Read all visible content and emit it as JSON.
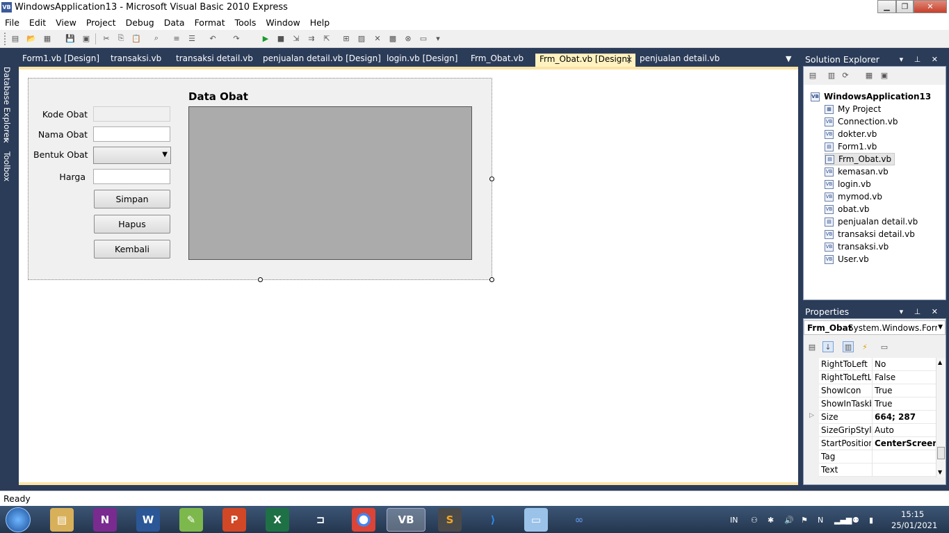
{
  "window": {
    "title": "WindowsApplication13 - Microsoft Visual Basic 2010 Express",
    "app_icon": "VB",
    "controls": [
      "minimize-icon",
      "maximize-icon",
      "close-icon"
    ]
  },
  "menu": [
    "File",
    "Edit",
    "View",
    "Project",
    "Debug",
    "Data",
    "Format",
    "Tools",
    "Window",
    "Help"
  ],
  "left_strip": {
    "database_explorer": "Database Explorer",
    "toolbox": "Toolbox"
  },
  "doc_tabs": [
    {
      "label": "Form1.vb [Design]"
    },
    {
      "label": "transaksi.vb"
    },
    {
      "label": "transaksi detail.vb"
    },
    {
      "label": "penjualan detail.vb [Design]"
    },
    {
      "label": "login.vb [Design]"
    },
    {
      "label": "Frm_Obat.vb"
    },
    {
      "label": "Frm_Obat.vb [Design]",
      "active": true
    },
    {
      "label": "penjualan detail.vb"
    }
  ],
  "form": {
    "labels": {
      "kode": "Kode Obat",
      "nama": "Nama Obat",
      "bentuk": "Bentuk Obat",
      "harga": "Harga"
    },
    "buttons": {
      "simpan": "Simpan",
      "hapus": "Hapus",
      "kembali": "Kembali"
    },
    "grid_title": "Data Obat"
  },
  "solution_explorer": {
    "title": "Solution Explorer",
    "root": "WindowsApplication13",
    "items": [
      "My Project",
      "Connection.vb",
      "dokter.vb",
      "Form1.vb",
      "Frm_Obat.vb",
      "kemasan.vb",
      "login.vb",
      "mymod.vb",
      "obat.vb",
      "penjualan detail.vb",
      "transaksi detail.vb",
      "transaksi.vb",
      "User.vb"
    ],
    "selected": "Frm_Obat.vb"
  },
  "properties": {
    "title": "Properties",
    "object_name": "Frm_Obat",
    "object_type": "System.Windows.Forms",
    "rows": [
      {
        "name": "RightToLeft",
        "value": "No"
      },
      {
        "name": "RightToLeftLa",
        "value": "False"
      },
      {
        "name": "ShowIcon",
        "value": "True"
      },
      {
        "name": "ShowInTaskb",
        "value": "True"
      },
      {
        "name": "Size",
        "value": "664; 287",
        "bold": true
      },
      {
        "name": "SizeGripStyle",
        "value": "Auto"
      },
      {
        "name": "StartPosition",
        "value": "CenterScreen",
        "bold": true
      },
      {
        "name": "Tag",
        "value": ""
      },
      {
        "name": "Text",
        "value": ""
      }
    ]
  },
  "status": "Ready",
  "taskbar": {
    "lang": "IN",
    "time": "15:15",
    "date": "25/01/2021"
  }
}
